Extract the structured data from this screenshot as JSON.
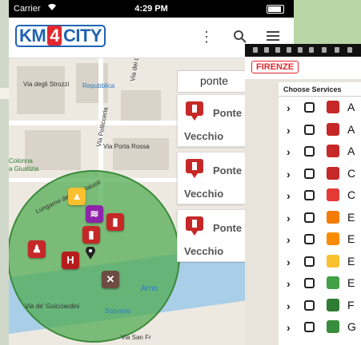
{
  "status": {
    "carrier": "Carrier",
    "time": "4:29 PM"
  },
  "logo": {
    "km": "KM",
    "num": "4",
    "city": "CITY"
  },
  "search": {
    "value": "ponte"
  },
  "results": [
    {
      "line1": "Ponte",
      "line2": "Vecchio"
    },
    {
      "line1": "Ponte",
      "line2": "Vecchio"
    },
    {
      "line1": "Ponte",
      "line2": "Vecchio"
    }
  ],
  "map_labels": {
    "strozzi": "Via degli Strozzi",
    "repubblica": "Repubblica",
    "calzaiuoli": "Via dei Calzaiuoli",
    "pellicceria": "Via Pellicceria",
    "porta_rossa": "Via Porta Rossa",
    "colonna": "Colonna",
    "giustizia": "a Giustizia",
    "lungarno_acciaiuoli": "Lungarno degli Acciaiuoli",
    "arno": "Arno",
    "guicciardini": "Via de' Guicciardini",
    "sopramo": "Sopramo",
    "san_fr": "Via San Fr"
  },
  "phone2": {
    "city_badge": "FIRENZE",
    "panel_title": "Choose Services",
    "services": [
      {
        "letter": "A",
        "color": "#c62828"
      },
      {
        "letter": "A",
        "color": "#c62828"
      },
      {
        "letter": "A",
        "color": "#c62828"
      },
      {
        "letter": "C",
        "color": "#c62828"
      },
      {
        "letter": "C",
        "color": "#e53935"
      },
      {
        "letter": "E",
        "color": "#f57c00"
      },
      {
        "letter": "E",
        "color": "#fb8c00"
      },
      {
        "letter": "E",
        "color": "#fbc02d"
      },
      {
        "letter": "E",
        "color": "#43a047"
      },
      {
        "letter": "F",
        "color": "#2e7d32"
      },
      {
        "letter": "G",
        "color": "#388e3c"
      }
    ]
  }
}
